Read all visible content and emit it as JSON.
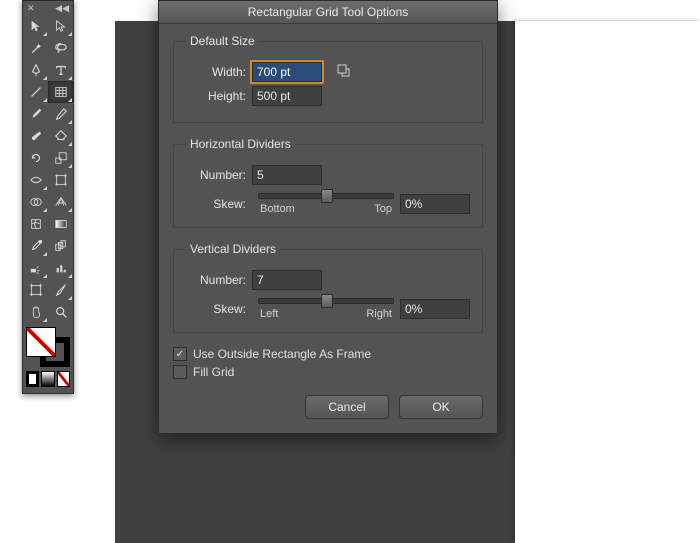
{
  "dialog": {
    "title": "Rectangular Grid Tool Options",
    "default_size": {
      "legend": "Default Size",
      "width_label": "Width:",
      "width_value": "700 pt",
      "height_label": "Height:",
      "height_value": "500 pt"
    },
    "h_div": {
      "legend": "Horizontal Dividers",
      "number_label": "Number:",
      "number_value": "5",
      "skew_label": "Skew:",
      "skew_value": "0%",
      "skew_min": "Bottom",
      "skew_max": "Top"
    },
    "v_div": {
      "legend": "Vertical Dividers",
      "number_label": "Number:",
      "number_value": "7",
      "skew_label": "Skew:",
      "skew_value": "0%",
      "skew_min": "Left",
      "skew_max": "Right"
    },
    "opt_frame": {
      "label": "Use Outside Rectangle As Frame",
      "checked": true
    },
    "opt_fill": {
      "label": "Fill Grid",
      "checked": false
    },
    "cancel": "Cancel",
    "ok": "OK"
  },
  "toolbox": {
    "tools": [
      "selection",
      "direct-selection",
      "magic-wand",
      "lasso",
      "pen",
      "type",
      "line-segment",
      "rectangle",
      "paintbrush",
      "pencil",
      "blob-brush",
      "eraser",
      "rotate",
      "scale",
      "width",
      "free-transform",
      "shape-builder",
      "perspective-grid",
      "mesh",
      "gradient",
      "eyedropper",
      "blend",
      "symbol-sprayer",
      "column-graph",
      "artboard",
      "slice",
      "hand",
      "zoom"
    ],
    "active_index": 7
  }
}
